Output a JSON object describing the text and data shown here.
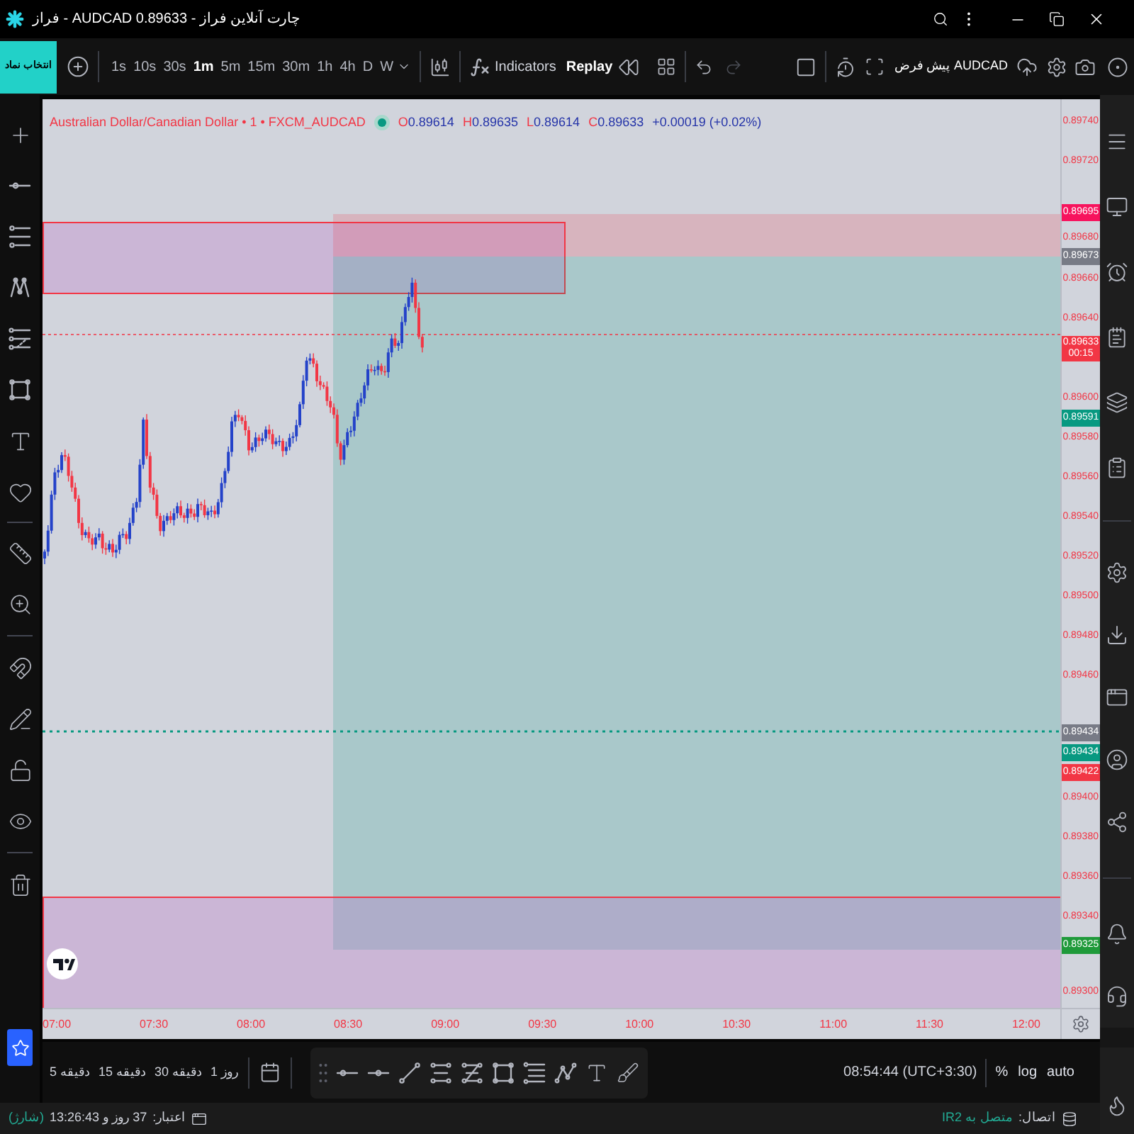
{
  "window": {
    "title": "فراز - AUDCAD 0.89633 - چارت آنلاین فراز"
  },
  "toolbar": {
    "symbol_button": "انتخاب نماد",
    "intervals": [
      {
        "label": "1s",
        "selected": false
      },
      {
        "label": "10s",
        "selected": false
      },
      {
        "label": "30s",
        "selected": false
      },
      {
        "label": "1m",
        "selected": true
      },
      {
        "label": "5m",
        "selected": false
      },
      {
        "label": "15m",
        "selected": false
      },
      {
        "label": "30m",
        "selected": false
      },
      {
        "label": "1h",
        "selected": false
      },
      {
        "label": "4h",
        "selected": false
      },
      {
        "label": "D",
        "selected": false
      },
      {
        "label": "W",
        "selected": false
      }
    ],
    "indicators": "Indicators",
    "replay": "Replay",
    "layout_name": "پیش فرض AUDCAD"
  },
  "chart": {
    "legend": {
      "title": "Australian Dollar/Canadian Dollar • 1 • FXCM_AUDCAD",
      "ohlc": [
        {
          "label": "O",
          "value": "0.89614"
        },
        {
          "label": "H",
          "value": "0.89635"
        },
        {
          "label": "L",
          "value": "0.89614"
        },
        {
          "label": "C",
          "value": "0.89633"
        }
      ],
      "change": "+0.00019 (+0.02%)"
    },
    "price_axis": [
      {
        "kind": "tick",
        "label": "0.89740"
      },
      {
        "kind": "tick",
        "label": "0.89720"
      },
      {
        "kind": "tag",
        "label": "0.89695",
        "color": "#f7135d"
      },
      {
        "kind": "tick",
        "label": "0.89680"
      },
      {
        "kind": "tag",
        "label": "0.89673",
        "color": "#787b86"
      },
      {
        "kind": "tick",
        "label": "0.89660"
      },
      {
        "kind": "tick",
        "label": "0.89640"
      },
      {
        "kind": "tag",
        "label": "0.89633",
        "sublabel": "00:15",
        "color": "#f23645"
      },
      {
        "kind": "tick",
        "label": "0.89600"
      },
      {
        "kind": "tag",
        "label": "0.89591",
        "color": "#089981"
      },
      {
        "kind": "tick",
        "label": "0.89580"
      },
      {
        "kind": "tick",
        "label": "0.89560"
      },
      {
        "kind": "tick",
        "label": "0.89540"
      },
      {
        "kind": "tick",
        "label": "0.89520"
      },
      {
        "kind": "tick",
        "label": "0.89500"
      },
      {
        "kind": "tick",
        "label": "0.89480"
      },
      {
        "kind": "tick",
        "label": "0.89460"
      },
      {
        "kind": "tag",
        "label": "0.89434",
        "color": "#787b86"
      },
      {
        "kind": "tag",
        "label": "0.89434",
        "color": "#089981"
      },
      {
        "kind": "tag",
        "label": "0.89422",
        "color": "#f23645"
      },
      {
        "kind": "tick",
        "label": "0.89400"
      },
      {
        "kind": "tick",
        "label": "0.89380"
      },
      {
        "kind": "tick",
        "label": "0.89360"
      },
      {
        "kind": "tick",
        "label": "0.89340"
      },
      {
        "kind": "tag",
        "label": "0.89325",
        "color": "#1f9a3a"
      },
      {
        "kind": "tick",
        "label": "0.89300"
      }
    ],
    "time_axis": [
      "07:00",
      "07:30",
      "08:00",
      "08:30",
      "09:00",
      "09:30",
      "10:00",
      "10:30",
      "11:00",
      "11:30",
      "12:00"
    ]
  },
  "bottom_toolbar": {
    "ranges": [
      "1 روز",
      "30 دقیقه",
      "15 دقیقه",
      "5 دقیقه"
    ],
    "clock": "08:54:44 (UTC+3:30)",
    "scale_options": [
      "%",
      "log",
      "auto"
    ]
  },
  "status_bar": {
    "credit_label": "اعتبار:",
    "credit_value": "37 روز و 13:26:43",
    "recharge_link": "(شارژ)",
    "connection_label": "اتصال:",
    "connection_value": "متصل به IR2"
  }
}
